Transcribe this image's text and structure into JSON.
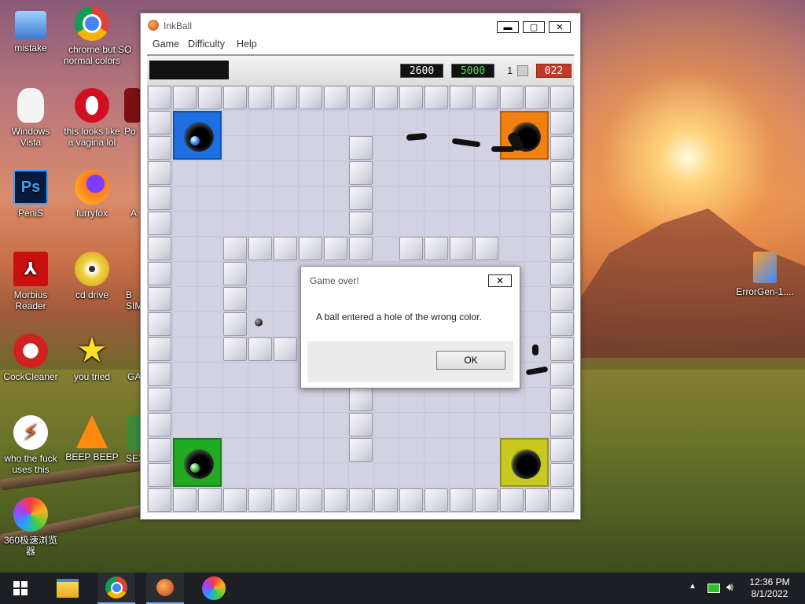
{
  "desktop": {
    "icons": [
      {
        "label": "mistake"
      },
      {
        "label": "chrome but normal colors"
      },
      {
        "label": "SO"
      },
      {
        "label": "Windows Vista"
      },
      {
        "label": "this looks like a vagina lol"
      },
      {
        "label": "Po"
      },
      {
        "label": "PeniS"
      },
      {
        "label": "furryfox"
      },
      {
        "label": "A"
      },
      {
        "label": "Morbius Reader"
      },
      {
        "label": "cd drive"
      },
      {
        "label": "B SIM"
      },
      {
        "label": "CockCleaner"
      },
      {
        "label": "you tried"
      },
      {
        "label": "GA"
      },
      {
        "label": "who the fuck uses this"
      },
      {
        "label": "BEEP BEEP"
      },
      {
        "label": "SEX"
      },
      {
        "label": "360极速浏览器"
      },
      {
        "label": "ErrorGen-1...."
      }
    ]
  },
  "window": {
    "title": "InkBall",
    "menu": [
      "Game",
      "Difficulty",
      "Help"
    ],
    "controls": {
      "minimize": "▬",
      "maximize": "▢",
      "close": "✕"
    }
  },
  "hud": {
    "score": "2600",
    "target_score": "5000",
    "balls_count": "1",
    "timer": "022",
    "colors": {
      "score": "#ffffff",
      "target": "#5cd65c",
      "timer_bg": "#c03a2a"
    }
  },
  "board": {
    "holes": [
      {
        "color": "blue",
        "hex": "#1e6fe0"
      },
      {
        "color": "orange",
        "hex": "#f08010"
      },
      {
        "color": "green",
        "hex": "#22aa22"
      },
      {
        "color": "yellow",
        "hex": "#c8c820"
      }
    ]
  },
  "dialog": {
    "title": "Game over!",
    "close": "✕",
    "message": "A ball entered a hole of the wrong color.",
    "ok_label": "OK"
  },
  "taskbar": {
    "time": "12:36 PM",
    "date": "8/1/2022",
    "apps": [
      "start-icon",
      "file-explorer-icon",
      "chrome-icon",
      "inkball-icon",
      "browser-360-icon"
    ]
  }
}
